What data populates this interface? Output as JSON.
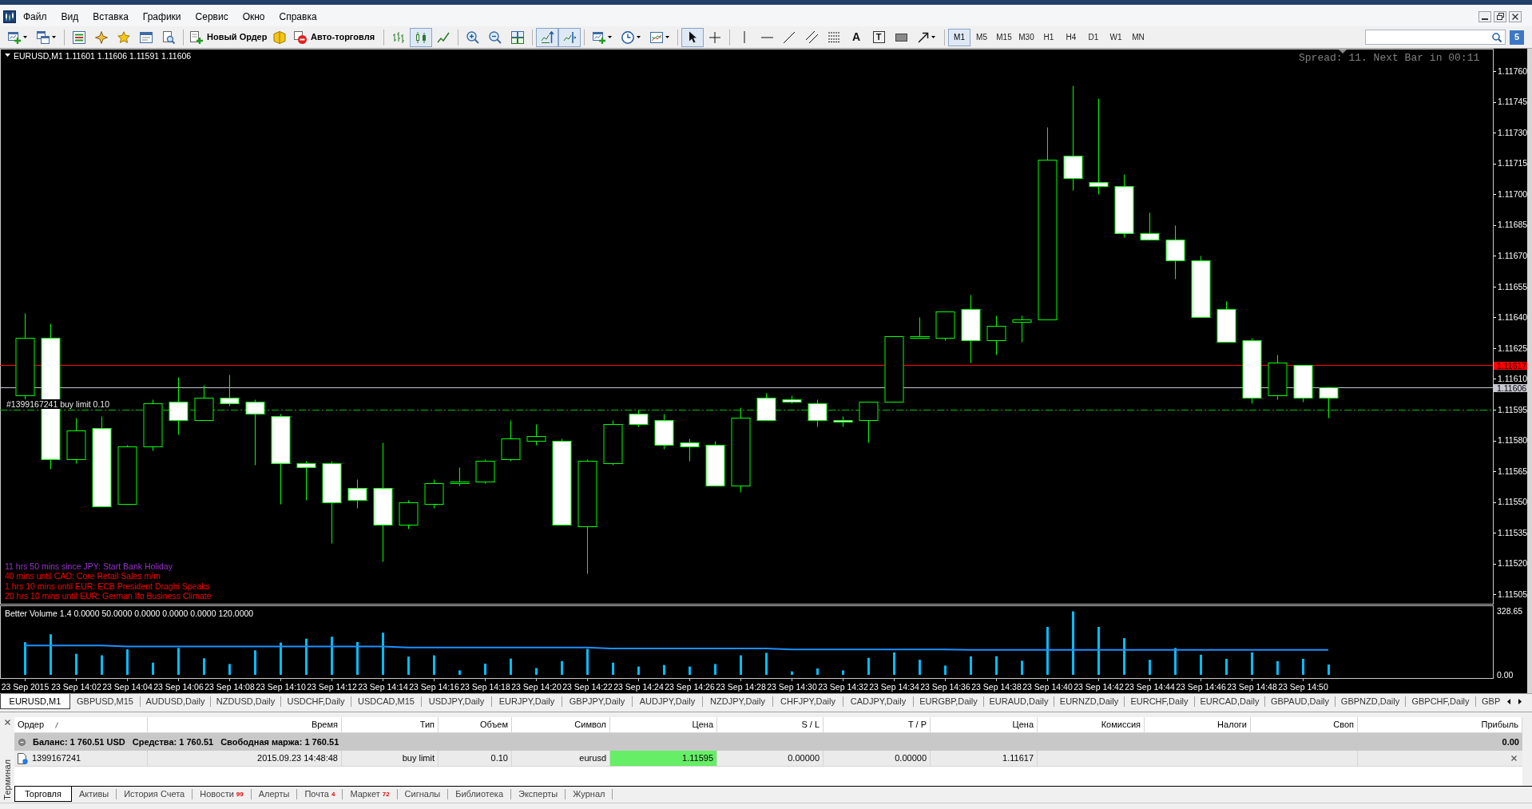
{
  "menu": {
    "items": [
      "Файл",
      "Вид",
      "Вставка",
      "Графики",
      "Сервис",
      "Окно",
      "Справка"
    ]
  },
  "toolbar": {
    "order_buttons": [
      {
        "kind": "new-order",
        "label": "Новый Ордер"
      },
      {
        "kind": "autotrading",
        "label": "Авто-торговля"
      }
    ],
    "chart_types": [
      {
        "kind": "bars",
        "selected": false
      },
      {
        "kind": "candles",
        "selected": true
      },
      {
        "kind": "line",
        "selected": false
      }
    ],
    "chart_options": [
      {
        "kind": "auto-scroll",
        "selected": true
      },
      {
        "kind": "chart-shift",
        "selected": true
      }
    ],
    "cursor_tools": [
      {
        "kind": "cursor",
        "selected": true
      },
      {
        "kind": "crosshair",
        "selected": false
      }
    ],
    "text_tools": [
      {
        "kind": "text",
        "label": "A"
      },
      {
        "kind": "text-label",
        "label": "T"
      }
    ],
    "timeframes": [
      {
        "label": "M1",
        "selected": true
      },
      {
        "label": "M5",
        "selected": false
      },
      {
        "label": "M15",
        "selected": false
      },
      {
        "label": "M30",
        "selected": false
      },
      {
        "label": "H1",
        "selected": false
      },
      {
        "label": "H4",
        "selected": false
      },
      {
        "label": "D1",
        "selected": false
      },
      {
        "label": "W1",
        "selected": false
      },
      {
        "label": "MN",
        "selected": false
      }
    ],
    "community_button": {
      "label": "5"
    }
  },
  "chart": {
    "spread_info": "Spread: 11. Next Bar in 00:11",
    "events": [
      {
        "text": "11 hrs 50 mins since JPY: Start Bank Holiday",
        "color": "#9932cc"
      },
      {
        "text": "40 mins until CAD: Core Retail Sales m/m",
        "color": "#ff0000"
      },
      {
        "text": "1 hrs 10 mins until EUR: ECB President Draghi Speaks",
        "color": "#ff0000"
      },
      {
        "text": "20 hrs 10 mins until EUR: German Ifo Business Climate",
        "color": "#ff0000"
      }
    ],
    "chart_data": [
      {
        "type": "candlestick",
        "title": "EURUSD,M1 1.11601 1.11606 1.11591 1.11606",
        "x": [
          "2015-09-23T14:00",
          "2015-09-23T14:01",
          "2015-09-23T14:02",
          "2015-09-23T14:03",
          "2015-09-23T14:04",
          "2015-09-23T14:05",
          "2015-09-23T14:06",
          "2015-09-23T14:07",
          "2015-09-23T14:08",
          "2015-09-23T14:09",
          "2015-09-23T14:10",
          "2015-09-23T14:11",
          "2015-09-23T14:12",
          "2015-09-23T14:13",
          "2015-09-23T14:14",
          "2015-09-23T14:15",
          "2015-09-23T14:16",
          "2015-09-23T14:17",
          "2015-09-23T14:18",
          "2015-09-23T14:19",
          "2015-09-23T14:20",
          "2015-09-23T14:21",
          "2015-09-23T14:22",
          "2015-09-23T14:23",
          "2015-09-23T14:24",
          "2015-09-23T14:25",
          "2015-09-23T14:26",
          "2015-09-23T14:27",
          "2015-09-23T14:28",
          "2015-09-23T14:29",
          "2015-09-23T14:30",
          "2015-09-23T14:31",
          "2015-09-23T14:32",
          "2015-09-23T14:33",
          "2015-09-23T14:34",
          "2015-09-23T14:35",
          "2015-09-23T14:36",
          "2015-09-23T14:37",
          "2015-09-23T14:38",
          "2015-09-23T14:39",
          "2015-09-23T14:40",
          "2015-09-23T14:41",
          "2015-09-23T14:42",
          "2015-09-23T14:43",
          "2015-09-23T14:44",
          "2015-09-23T14:45",
          "2015-09-23T14:46",
          "2015-09-23T14:47",
          "2015-09-23T14:48",
          "2015-09-23T14:49",
          "2015-09-23T14:50",
          "2015-09-23T14:51"
        ],
        "xlim": [
          "2015-09-23T13:59:02",
          "2015-09-23T14:57:26"
        ],
        "ohlc": [
          [
            1.11602,
            1.11642,
            1.116,
            1.1163
          ],
          [
            1.1163,
            1.11637,
            1.11566,
            1.11571
          ],
          [
            1.11571,
            1.11591,
            1.11569,
            1.11585
          ],
          [
            1.11586,
            1.11592,
            1.11548,
            1.11548
          ],
          [
            1.11549,
            1.11578,
            1.11549,
            1.11577
          ],
          [
            1.11577,
            1.116,
            1.11575,
            1.11598
          ],
          [
            1.11599,
            1.11611,
            1.11583,
            1.1159
          ],
          [
            1.1159,
            1.11607,
            1.1159,
            1.11601
          ],
          [
            1.11601,
            1.11612,
            1.11597,
            1.11598
          ],
          [
            1.11599,
            1.116,
            1.11568,
            1.11593
          ],
          [
            1.11592,
            1.11593,
            1.11549,
            1.11569
          ],
          [
            1.11569,
            1.1157,
            1.11551,
            1.11567
          ],
          [
            1.11569,
            1.1157,
            1.1153,
            1.1155
          ],
          [
            1.11557,
            1.11561,
            1.11547,
            1.11551
          ],
          [
            1.11557,
            1.11579,
            1.11521,
            1.11539
          ],
          [
            1.11539,
            1.11551,
            1.11537,
            1.1155
          ],
          [
            1.11549,
            1.11561,
            1.11547,
            1.11559
          ],
          [
            1.11559,
            1.11567,
            1.11558,
            1.1156
          ],
          [
            1.1156,
            1.11571,
            1.11559,
            1.1157
          ],
          [
            1.11571,
            1.1159,
            1.1157,
            1.11581
          ],
          [
            1.1158,
            1.11588,
            1.11578,
            1.11582
          ],
          [
            1.1158,
            1.11581,
            1.11539,
            1.11539
          ],
          [
            1.11538,
            1.11571,
            1.11515,
            1.1157
          ],
          [
            1.11569,
            1.1159,
            1.11568,
            1.11588
          ],
          [
            1.11593,
            1.11595,
            1.11587,
            1.11588
          ],
          [
            1.1159,
            1.11593,
            1.11576,
            1.11578
          ],
          [
            1.11579,
            1.11581,
            1.1157,
            1.11577
          ],
          [
            1.11578,
            1.1158,
            1.11558,
            1.11558
          ],
          [
            1.11558,
            1.11596,
            1.11555,
            1.11591
          ],
          [
            1.11601,
            1.11603,
            1.1159,
            1.1159
          ],
          [
            1.116,
            1.11602,
            1.11598,
            1.11599
          ],
          [
            1.11598,
            1.116,
            1.11587,
            1.1159
          ],
          [
            1.1159,
            1.11592,
            1.11587,
            1.11589
          ],
          [
            1.1159,
            1.11599,
            1.11579,
            1.11599
          ],
          [
            1.11599,
            1.11631,
            1.11599,
            1.11631
          ],
          [
            1.1163,
            1.1164,
            1.1163,
            1.11631
          ],
          [
            1.1163,
            1.11643,
            1.11629,
            1.11643
          ],
          [
            1.11644,
            1.11651,
            1.11618,
            1.11629
          ],
          [
            1.11629,
            1.11641,
            1.11622,
            1.11636
          ],
          [
            1.11638,
            1.11641,
            1.11628,
            1.11639
          ],
          [
            1.11639,
            1.11733,
            1.11639,
            1.11717
          ],
          [
            1.11719,
            1.11753,
            1.11702,
            1.11708
          ],
          [
            1.11706,
            1.11747,
            1.117,
            1.11704
          ],
          [
            1.11704,
            1.1171,
            1.11679,
            1.11681
          ],
          [
            1.11681,
            1.11691,
            1.11678,
            1.11678
          ],
          [
            1.11678,
            1.11685,
            1.11659,
            1.11668
          ],
          [
            1.11668,
            1.1167,
            1.1164,
            1.1164
          ],
          [
            1.11644,
            1.11648,
            1.11628,
            1.11628
          ],
          [
            1.11629,
            1.1163,
            1.11598,
            1.11601
          ],
          [
            1.11602,
            1.11622,
            1.116,
            1.11618
          ],
          [
            1.11617,
            1.11617,
            1.11599,
            1.11601
          ],
          [
            1.11606,
            1.11606,
            1.11591,
            1.11601
          ]
        ],
        "ylim": [
          1.115,
          1.11771
        ],
        "yticks": [
          {
            "value": 1.11505,
            "label": "1.11505"
          },
          {
            "value": 1.1152,
            "label": "1.11520"
          },
          {
            "value": 1.11535,
            "label": "1.11535"
          },
          {
            "value": 1.1155,
            "label": "1.11550"
          },
          {
            "value": 1.11565,
            "label": "1.11565"
          },
          {
            "value": 1.1158,
            "label": "1.11580"
          },
          {
            "value": 1.11595,
            "label": "1.11595"
          },
          {
            "value": 1.1161,
            "label": "1.11610"
          },
          {
            "value": 1.11625,
            "label": "1.11625"
          },
          {
            "value": 1.1164,
            "label": "1.11640"
          },
          {
            "value": 1.11655,
            "label": "1.11655"
          },
          {
            "value": 1.1167,
            "label": "1.11670"
          },
          {
            "value": 1.11685,
            "label": "1.11685"
          },
          {
            "value": 1.117,
            "label": "1.11700"
          },
          {
            "value": 1.11715,
            "label": "1.11715"
          },
          {
            "value": 1.1173,
            "label": "1.11730"
          },
          {
            "value": 1.11745,
            "label": "1.11745"
          },
          {
            "value": 1.1176,
            "label": "1.11760"
          }
        ],
        "tick_labels": "y",
        "ref_lines": [
          {
            "axis": "y",
            "value": 1.11617,
            "label": "1.11617",
            "color": "#ff0000",
            "line_style": "solid"
          },
          {
            "axis": "y",
            "value": 1.11606,
            "label": "1.11606",
            "color": "#c8c8d2",
            "line_style": "solid"
          },
          {
            "axis": "y",
            "value": 1.11595,
            "label": "#1399167241 buy limit 0.10",
            "color": "#00c000",
            "line_style": "dashdot"
          }
        ]
      },
      {
        "type": "bar",
        "title": "Better Volume 1.4 0.0000 50.0000 0.0000 0.0000 0.0000 120.0000",
        "x": [
          "2015-09-23T14:00",
          "2015-09-23T14:01",
          "2015-09-23T14:02",
          "2015-09-23T14:03",
          "2015-09-23T14:04",
          "2015-09-23T14:05",
          "2015-09-23T14:06",
          "2015-09-23T14:07",
          "2015-09-23T14:08",
          "2015-09-23T14:09",
          "2015-09-23T14:10",
          "2015-09-23T14:11",
          "2015-09-23T14:12",
          "2015-09-23T14:13",
          "2015-09-23T14:14",
          "2015-09-23T14:15",
          "2015-09-23T14:16",
          "2015-09-23T14:17",
          "2015-09-23T14:18",
          "2015-09-23T14:19",
          "2015-09-23T14:20",
          "2015-09-23T14:21",
          "2015-09-23T14:22",
          "2015-09-23T14:23",
          "2015-09-23T14:24",
          "2015-09-23T14:25",
          "2015-09-23T14:26",
          "2015-09-23T14:27",
          "2015-09-23T14:28",
          "2015-09-23T14:29",
          "2015-09-23T14:30",
          "2015-09-23T14:31",
          "2015-09-23T14:32",
          "2015-09-23T14:33",
          "2015-09-23T14:34",
          "2015-09-23T14:35",
          "2015-09-23T14:36",
          "2015-09-23T14:37",
          "2015-09-23T14:38",
          "2015-09-23T14:39",
          "2015-09-23T14:40",
          "2015-09-23T14:41",
          "2015-09-23T14:42",
          "2015-09-23T14:43",
          "2015-09-23T14:44",
          "2015-09-23T14:45",
          "2015-09-23T14:46",
          "2015-09-23T14:47",
          "2015-09-23T14:48",
          "2015-09-23T14:49",
          "2015-09-23T14:50",
          "2015-09-23T14:51"
        ],
        "xlim": [
          "2015-09-23T13:59:02",
          "2015-09-23T14:57:26"
        ],
        "xticks": [
          {
            "value": "2015-09-23T14:00",
            "label": "23 Sep 2015"
          },
          {
            "value": "2015-09-23T14:02",
            "label": "23 Sep 14:02"
          },
          {
            "value": "2015-09-23T14:04",
            "label": "23 Sep 14:04"
          },
          {
            "value": "2015-09-23T14:06",
            "label": "23 Sep 14:06"
          },
          {
            "value": "2015-09-23T14:08",
            "label": "23 Sep 14:08"
          },
          {
            "value": "2015-09-23T14:10",
            "label": "23 Sep 14:10"
          },
          {
            "value": "2015-09-23T14:12",
            "label": "23 Sep 14:12"
          },
          {
            "value": "2015-09-23T14:14",
            "label": "23 Sep 14:14"
          },
          {
            "value": "2015-09-23T14:16",
            "label": "23 Sep 14:16"
          },
          {
            "value": "2015-09-23T14:18",
            "label": "23 Sep 14:18"
          },
          {
            "value": "2015-09-23T14:20",
            "label": "23 Sep 14:20"
          },
          {
            "value": "2015-09-23T14:22",
            "label": "23 Sep 14:22"
          },
          {
            "value": "2015-09-23T14:24",
            "label": "23 Sep 14:24"
          },
          {
            "value": "2015-09-23T14:26",
            "label": "23 Sep 14:26"
          },
          {
            "value": "2015-09-23T14:28",
            "label": "23 Sep 14:28"
          },
          {
            "value": "2015-09-23T14:30",
            "label": "23 Sep 14:30"
          },
          {
            "value": "2015-09-23T14:32",
            "label": "23 Sep 14:32"
          },
          {
            "value": "2015-09-23T14:34",
            "label": "23 Sep 14:34"
          },
          {
            "value": "2015-09-23T14:36",
            "label": "23 Sep 14:36"
          },
          {
            "value": "2015-09-23T14:38",
            "label": "23 Sep 14:38"
          },
          {
            "value": "2015-09-23T14:40",
            "label": "23 Sep 14:40"
          },
          {
            "value": "2015-09-23T14:42",
            "label": "23 Sep 14:42"
          },
          {
            "value": "2015-09-23T14:44",
            "label": "23 Sep 14:44"
          },
          {
            "value": "2015-09-23T14:46",
            "label": "23 Sep 14:46"
          },
          {
            "value": "2015-09-23T14:48",
            "label": "23 Sep 14:48"
          },
          {
            "value": "2015-09-23T14:50",
            "label": "23 Sep 14:50"
          }
        ],
        "series": [
          {
            "type": "bar",
            "color": "#00bfff",
            "values": [
              169,
              210,
              109,
              101,
              132,
              63,
              139,
              86,
              56,
              127,
              167,
              187,
              197,
              170,
              218,
              94,
              101,
              23,
              58,
              84,
              35,
              71,
              134,
              63,
              43,
              51,
              43,
              56,
              101,
              114,
              18,
              33,
              23,
              88,
              116,
              78,
              48,
              96,
              96,
              73,
              248,
              328.65,
              248,
              190,
              78,
              139,
              104,
              83,
              116,
              71,
              83,
              53
            ]
          },
          {
            "type": "line",
            "color": "#1e90ff",
            "values": [
              152,
              152,
              152,
              152,
              147,
              147,
              147,
              147,
              147,
              147,
              147,
              147,
              147,
              147,
              147,
              142,
              142,
              142,
              142,
              142,
              142,
              142,
              142,
              136,
              136,
              136,
              136,
              136,
              136,
              136,
              131,
              131,
              131,
              131,
              131,
              131,
              131,
              129,
              129,
              129,
              129,
              129,
              129,
              129,
              129,
              129,
              129,
              129,
              129,
              129,
              129,
              129
            ]
          }
        ],
        "ylim": [
          -18.6,
          357.6
        ],
        "yticks": [
          {
            "value": 328.65,
            "label": "328.65"
          },
          {
            "value": 0,
            "label": "0.00"
          }
        ]
      }
    ]
  },
  "symbol_tabs": [
    {
      "label": "EURUSD,M1",
      "selected": true
    },
    {
      "label": "GBPUSD,M15",
      "selected": false
    },
    {
      "label": "AUDUSD,Daily",
      "selected": false
    },
    {
      "label": "NZDUSD,Daily",
      "selected": false
    },
    {
      "label": "USDCHF,Daily",
      "selected": false
    },
    {
      "label": "USDCAD,M15",
      "selected": false
    },
    {
      "label": "USDJPY,Daily",
      "selected": false
    },
    {
      "label": "EURJPY,Daily",
      "selected": false
    },
    {
      "label": "GBPJPY,Daily",
      "selected": false
    },
    {
      "label": "AUDJPY,Daily",
      "selected": false
    },
    {
      "label": "NZDJPY,Daily",
      "selected": false
    },
    {
      "label": "CHFJPY,Daily",
      "selected": false
    },
    {
      "label": "CADJPY,Daily",
      "selected": false
    },
    {
      "label": "EURGBP,Daily",
      "selected": false
    },
    {
      "label": "EURAUD,Daily",
      "selected": false
    },
    {
      "label": "EURNZD,Daily",
      "selected": false
    },
    {
      "label": "EURCHF,Daily",
      "selected": false
    },
    {
      "label": "EURCAD,Daily",
      "selected": false
    },
    {
      "label": "GBPAUD,Daily",
      "selected": false
    },
    {
      "label": "GBPNZD,Daily",
      "selected": false
    },
    {
      "label": "GBPCHF,Daily",
      "selected": false
    },
    {
      "label": "GBP",
      "selected": false
    }
  ],
  "terminal": {
    "title": "Терминал",
    "columns": [
      {
        "label": "Ордер",
        "sorted": true
      },
      {
        "label": "Время",
        "sorted": false
      },
      {
        "label": "Тип",
        "sorted": false
      },
      {
        "label": "Объем",
        "sorted": false
      },
      {
        "label": "Символ",
        "sorted": false
      },
      {
        "label": "Цена",
        "sorted": false
      },
      {
        "label": "S / L",
        "sorted": false
      },
      {
        "label": "T / P",
        "sorted": false
      },
      {
        "label": "Цена",
        "sorted": false
      },
      {
        "label": "Комиссия",
        "sorted": false
      },
      {
        "label": "Налоги",
        "sorted": false
      },
      {
        "label": "Своп",
        "sorted": false
      },
      {
        "label": "Прибыль",
        "sorted": false
      }
    ],
    "balance": {
      "parts": [
        "Баланс: 1 760.51 USD",
        "Средства: 1 760.51",
        "Свободная маржа: 1 760.51"
      ],
      "profit": "0.00"
    },
    "orders": [
      {
        "order": "1399167241",
        "time": "2015.09.23 14:48:48",
        "type": "buy limit",
        "volume": "0.10",
        "symbol": "eurusd",
        "price": "1.11595",
        "price_highlight": true,
        "sl": "0.00000",
        "tp": "0.00000",
        "current_price": "1.11617"
      }
    ],
    "tabs": [
      {
        "label": "Торговля",
        "selected": true
      },
      {
        "label": "Активы",
        "selected": false
      },
      {
        "label": "История Счета",
        "selected": false
      },
      {
        "label": "Новости",
        "badge": "99",
        "selected": false
      },
      {
        "label": "Алерты",
        "selected": false
      },
      {
        "label": "Почта",
        "badge": "4",
        "selected": false
      },
      {
        "label": "Маркет",
        "badge": "72",
        "selected": false
      },
      {
        "label": "Сигналы",
        "selected": false
      },
      {
        "label": "Библиотека",
        "selected": false
      },
      {
        "label": "Эксперты",
        "selected": false
      },
      {
        "label": "Журнал",
        "selected": false
      }
    ]
  }
}
